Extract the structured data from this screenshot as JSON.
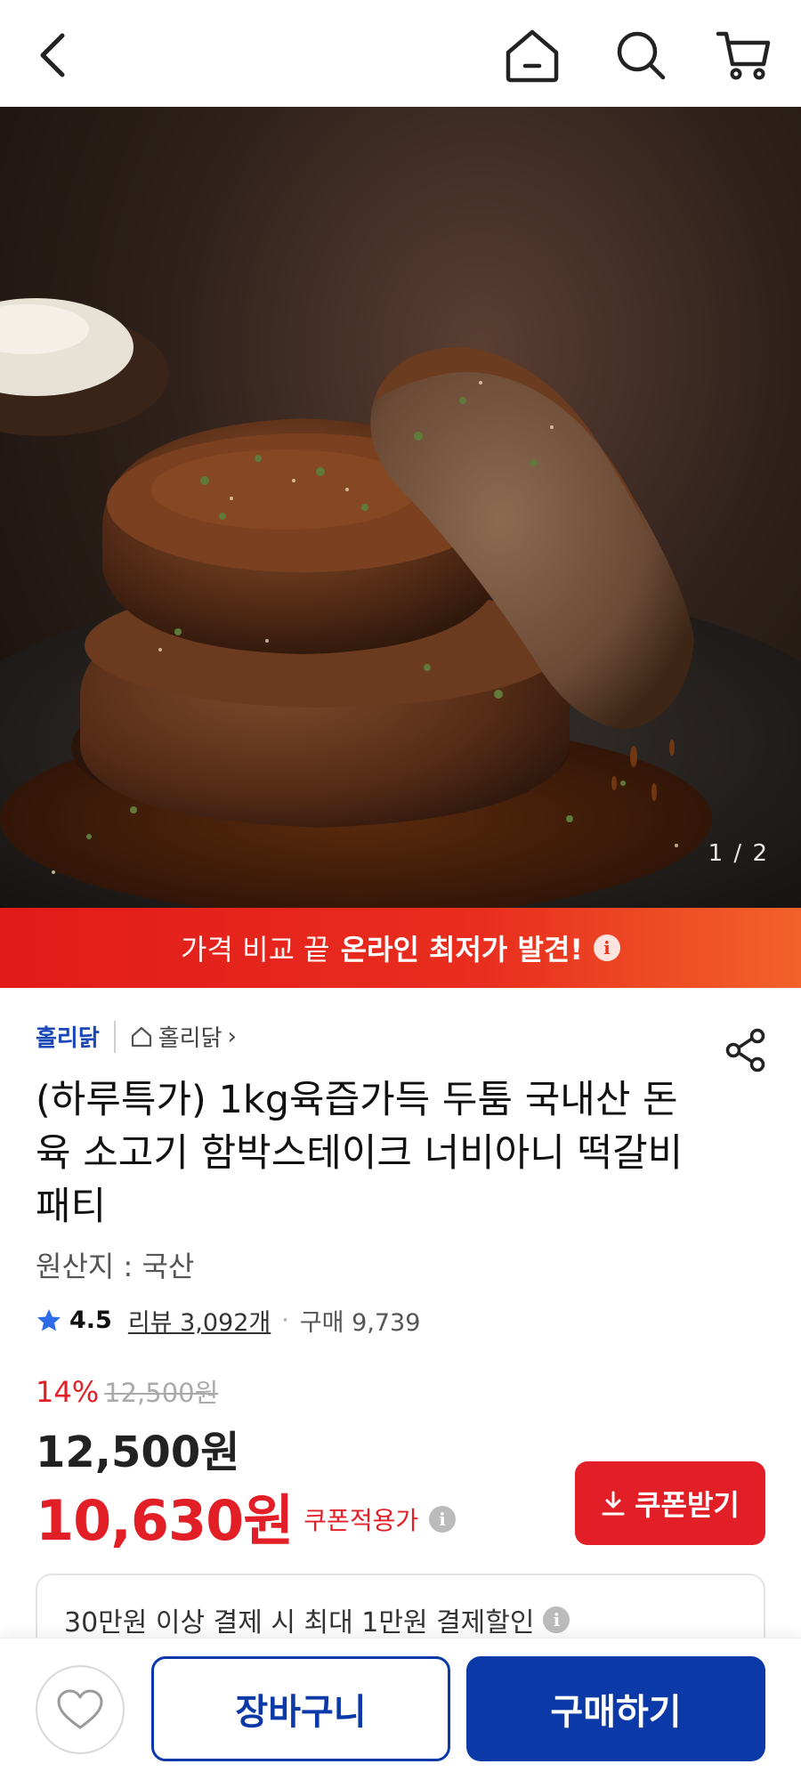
{
  "nav": {
    "back_icon": "chevron-left-icon",
    "home_icon": "home-icon",
    "search_icon": "search-icon",
    "cart_icon": "cart-icon"
  },
  "hero": {
    "image_counter": "1 / 2"
  },
  "promo": {
    "text_light": "가격 비교 끝",
    "text_bold": "온라인 최저가 발견!",
    "info_icon": "info-icon"
  },
  "product": {
    "brand": "홀리닭",
    "store_name": "홀리닭",
    "store_chevron": "›",
    "share_icon": "share-icon",
    "title": "(하루특가) 1kg육즙가득 두툼 국내산 돈육 소고기 함박스테이크 너비아니 떡갈비 패티",
    "origin": "원산지 : 국산",
    "rating": "4.5",
    "review_text": "리뷰 3,092개",
    "purchase_text": "구매 9,739",
    "discount_percent": "14%",
    "original_price": "12,500원",
    "sale_price": "12,500원",
    "coupon_price": "10,630원",
    "coupon_price_label": "쿠폰적용가",
    "coupon_button": "쿠폰받기",
    "payment_benefit": "30만원 이상 결제 시 최대 1만원 결제할인"
  },
  "bottom": {
    "wishlist_icon": "heart-icon",
    "cart_button": "장바구니",
    "buy_button": "구매하기"
  },
  "colors": {
    "accent_red": "#e21f26",
    "primary_blue": "#0b3aa8",
    "brand_blue": "#1a47b8"
  }
}
